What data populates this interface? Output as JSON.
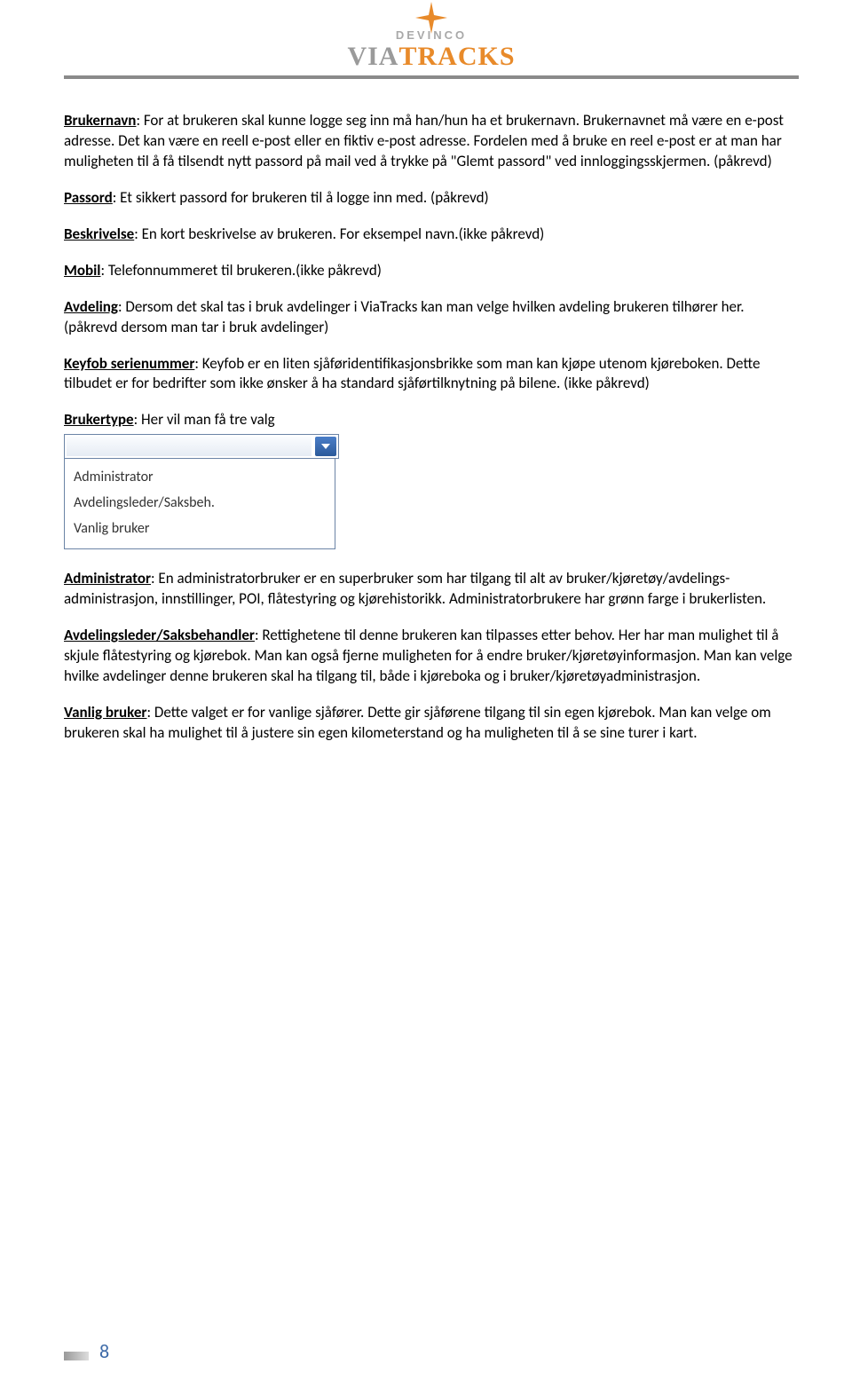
{
  "header": {
    "brand_top": "DEVINCO",
    "brand_via": "VIA",
    "brand_tracks": "TRACKS"
  },
  "content": {
    "p1_label": "Brukernavn",
    "p1_text": ": For at brukeren skal kunne logge seg inn må han/hun ha et brukernavn. Brukernavnet må være en e-post adresse. Det kan være en reell e-post eller en fiktiv e-post adresse. Fordelen med å bruke en reel e-post er at man har muligheten til å få tilsendt nytt passord på mail ved å trykke på \"Glemt passord\" ved innloggingsskjermen. (påkrevd)",
    "p2_label": "Passord",
    "p2_text": ": Et sikkert passord for brukeren til å logge inn med. (påkrevd)",
    "p3_label": "Beskrivelse",
    "p3_text": ": En kort beskrivelse av brukeren. For eksempel navn.(ikke påkrevd)",
    "p4_label": "Mobil",
    "p4_text": ": Telefonnummeret til brukeren.(ikke påkrevd)",
    "p5_label": "Avdeling",
    "p5_text": ": Dersom det skal tas i bruk avdelinger i ViaTracks kan man velge hvilken avdeling brukeren tilhører her. (påkrevd dersom man tar i bruk avdelinger)",
    "p6_label": "Keyfob serienummer",
    "p6_text": ": Keyfob er en liten sjåføridentifikasjonsbrikke som man kan kjøpe utenom kjøreboken. Dette tilbudet er for bedrifter som ikke ønsker å ha standard sjåførtilknytning på bilene. (ikke påkrevd)",
    "p7_label": "Brukertype",
    "p7_text": ": Her vil man få tre valg",
    "p8_label": "Administrator",
    "p8_text": ": En administratorbruker er en superbruker som har tilgang til alt av bruker/kjøretøy/avdelings-administrasjon, innstillinger, POI, flåtestyring og kjørehistorikk. Administratorbrukere har grønn farge i brukerlisten.",
    "p9_label": "Avdelingsleder/Saksbehandler",
    "p9_text": ": Rettighetene til denne brukeren kan tilpasses etter behov. Her har man mulighet til å skjule flåtestyring og kjørebok. Man kan også fjerne muligheten for å endre bruker/kjøretøyinformasjon. Man kan velge hvilke avdelinger denne brukeren skal ha tilgang til, både i kjøreboka og i bruker/kjøretøyadministrasjon.",
    "p10_label": "Vanlig bruker",
    "p10_text": ": Dette valget er for vanlige sjåfører. Dette gir sjåførene tilgang til sin egen kjørebok. Man kan velge om brukeren skal ha mulighet til å justere sin egen kilometerstand og ha muligheten til å se sine turer i kart."
  },
  "dropdown": {
    "option1": "Administrator",
    "option2": "Avdelingsleder/Saksbeh.",
    "option3": "Vanlig bruker"
  },
  "footer": {
    "page_number": "8"
  }
}
